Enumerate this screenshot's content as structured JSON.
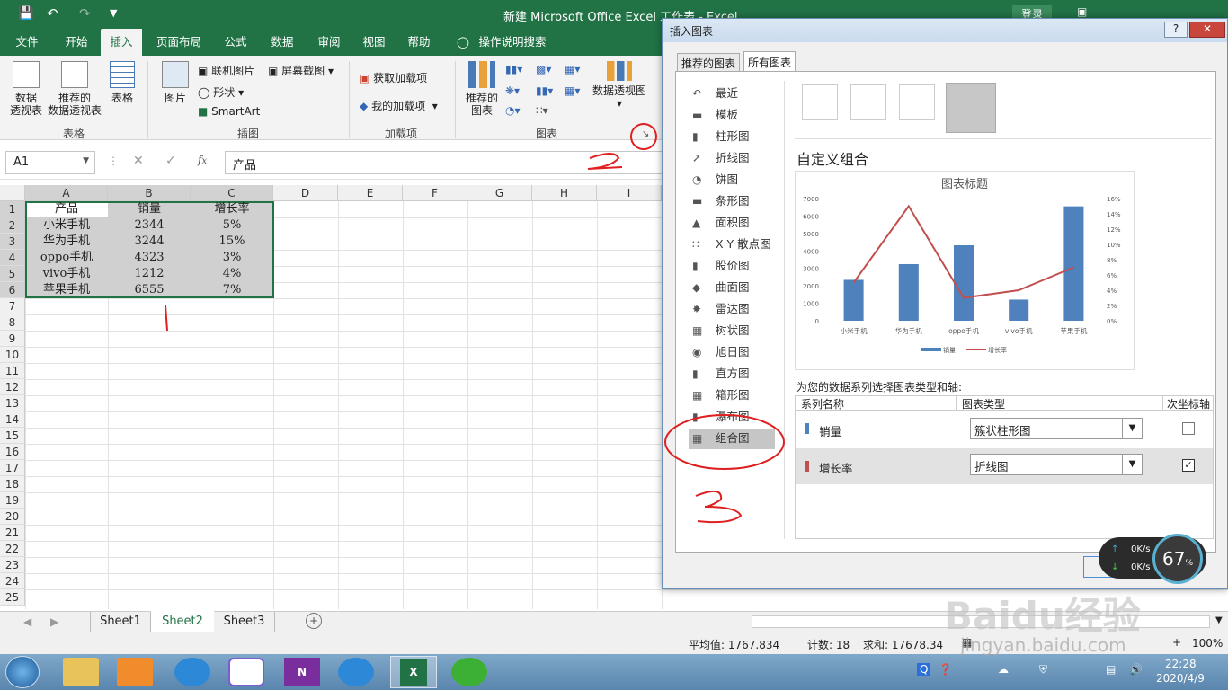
{
  "window": {
    "title": "新建 Microsoft Office Excel 工作表  -  Excel",
    "login": "登录"
  },
  "tabs": [
    "文件",
    "开始",
    "插入",
    "页面布局",
    "公式",
    "数据",
    "审阅",
    "视图",
    "帮助"
  ],
  "tell_me": "操作说明搜索",
  "ribbon": {
    "pivot": "数据\n透视表",
    "rec_pivot": "推荐的\n数据透视表",
    "table": "表格",
    "grp_table": "表格",
    "picture": "图片",
    "online_pic": "联机图片",
    "shapes": "形状",
    "smartart": "SmartArt",
    "screenshot": "屏幕截图",
    "grp_illus": "插图",
    "get_addins": "获取加载项",
    "my_addins": "我的加载项",
    "grp_addins": "加载项",
    "rec_charts": "推荐的\n图表",
    "pivot_chart": "数据透视图",
    "grp_charts": "图表"
  },
  "formula": {
    "namebox": "A1",
    "content": "产品"
  },
  "columns": [
    "A",
    "B",
    "C",
    "D",
    "E",
    "F",
    "G",
    "H",
    "I"
  ],
  "rows": [
    "1",
    "2",
    "3",
    "4",
    "5",
    "6",
    "7",
    "8",
    "9",
    "10",
    "11",
    "12",
    "13",
    "14",
    "15",
    "16",
    "17",
    "18",
    "19",
    "20",
    "21",
    "22",
    "23",
    "24",
    "25"
  ],
  "table": [
    [
      "产品",
      "销量",
      "增长率"
    ],
    [
      "小米手机",
      "2344",
      "5%"
    ],
    [
      "华为手机",
      "3244",
      "15%"
    ],
    [
      "oppo手机",
      "4323",
      "3%"
    ],
    [
      "vivo手机",
      "1212",
      "4%"
    ],
    [
      "苹果手机",
      "6555",
      "7%"
    ]
  ],
  "sheets": [
    "Sheet1",
    "Sheet2",
    "Sheet3"
  ],
  "status": {
    "avg": "平均值: 1767.834",
    "count": "计数: 18",
    "sum": "求和: 17678.34",
    "zoom": "100%"
  },
  "dialog": {
    "title": "插入图表",
    "help": "?",
    "tab_rec": "推荐的图表",
    "tab_all": "所有图表",
    "categories": [
      "最近",
      "模板",
      "柱形图",
      "折线图",
      "饼图",
      "条形图",
      "面积图",
      "X Y 散点图",
      "股价图",
      "曲面图",
      "雷达图",
      "树状图",
      "旭日图",
      "直方图",
      "箱形图",
      "瀑布图",
      "组合图"
    ],
    "section_title": "自定义组合",
    "series_prompt": "为您的数据系列选择图表类型和轴:",
    "col_name": "系列名称",
    "col_type": "图表类型",
    "col_axis": "次坐标轴",
    "series": [
      {
        "name": "销量",
        "type": "簇状柱形图",
        "secondary": false,
        "color": "#4f81bd"
      },
      {
        "name": "增长率",
        "type": "折线图",
        "secondary": true,
        "color": "#c0504d"
      }
    ],
    "ok": "确定"
  },
  "chart_data": {
    "type": "bar",
    "title": "图表标题",
    "categories": [
      "小米手机",
      "华为手机",
      "oppo手机",
      "vivo手机",
      "苹果手机"
    ],
    "series": [
      {
        "name": "销量",
        "chart": "bar",
        "axis": "primary",
        "values": [
          2344,
          3244,
          4323,
          1212,
          6555
        ],
        "color": "#4f81bd"
      },
      {
        "name": "增长率",
        "chart": "line",
        "axis": "secondary",
        "values": [
          5,
          15,
          3,
          4,
          7
        ],
        "color": "#c0504d"
      }
    ],
    "yticks": [
      "0",
      "1000",
      "2000",
      "3000",
      "4000",
      "5000",
      "6000",
      "7000"
    ],
    "y2ticks": [
      "0%",
      "2%",
      "4%",
      "6%",
      "8%",
      "10%",
      "12%",
      "14%",
      "16%"
    ],
    "ylim": [
      0,
      7000
    ],
    "y2lim": [
      0,
      16
    ],
    "legend": "bottom"
  },
  "net": {
    "up": "0K/s",
    "down": "0K/s",
    "percent": "67",
    "unit": "%"
  },
  "watermark": {
    "brand": "Baidu经验",
    "url": "jingyan.baidu.com"
  },
  "taskbar": {
    "time": "22:28",
    "date": "2020/4/9"
  },
  "annotations": [
    "1",
    "2",
    "3"
  ]
}
